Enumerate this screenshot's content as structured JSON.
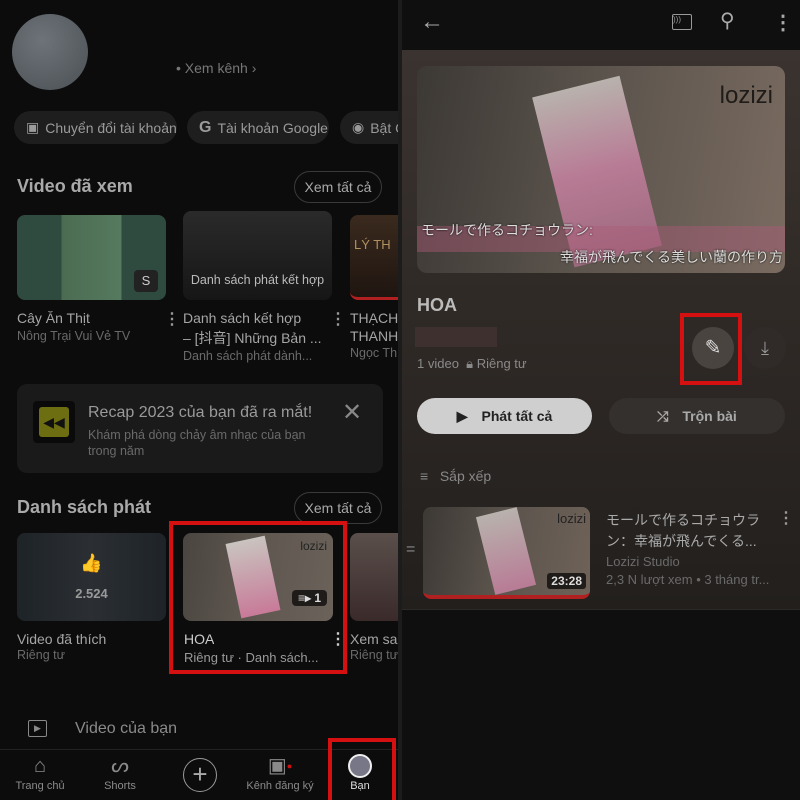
{
  "left": {
    "view_channel": "Xem kênh",
    "chips": [
      "Chuyển đổi tài khoản",
      "Tài khoản Google",
      "Bật C"
    ],
    "history": {
      "title": "Video đã xem",
      "see_all": "Xem tất cả",
      "items": [
        {
          "title": "Cây Ăn Thịt",
          "sub": "Nông Trại Vui Vẻ TV",
          "overlay": ""
        },
        {
          "title": "Danh sách kết hợp",
          "title2": "– [抖音] Những Bản ...",
          "sub": "Danh sách phát dành...",
          "overlay": "Danh sách phát kết hợp"
        },
        {
          "title": "THẠCH",
          "title2": "THANH",
          "sub": "Ngọc Th",
          "overlay": "LÝ TH"
        }
      ]
    },
    "recap": {
      "title": "Recap 2023 của bạn đã ra mắt!",
      "desc": "Khám phá dòng chảy âm nhạc của bạn trong năm"
    },
    "playlists": {
      "title": "Danh sách phát",
      "see_all": "Xem tất cả",
      "items": [
        {
          "title": "Video đã thích",
          "sub": "Riêng tư",
          "count": "2.524"
        },
        {
          "title": "HOA",
          "sub": "Riêng tư · Danh sách...",
          "count": "1",
          "brand": "lozizi"
        },
        {
          "title": "Xem sa",
          "sub": "Riêng tư"
        }
      ]
    },
    "your_videos": "Video của bạn",
    "nav": [
      {
        "label": "Trang chủ",
        "icon": "home-icon"
      },
      {
        "label": "Shorts",
        "icon": "shorts-icon"
      },
      {
        "label": "",
        "icon": "create-icon"
      },
      {
        "label": "Kênh đăng ký",
        "icon": "subscriptions-icon"
      },
      {
        "label": "Bạn",
        "icon": "you-avatar"
      }
    ]
  },
  "right": {
    "brand": "lozizi",
    "caption1": "モールで作るコチョウラン:",
    "caption2": "幸福が飛んでくる美しい蘭の作り方",
    "title": "HOA",
    "video_count": "1 video",
    "privacy": "Riêng tư",
    "play_all": "Phát tất cả",
    "shuffle": "Trộn bài",
    "sort": "Sắp xếp",
    "video": {
      "title1": "モールで作るコチョウラ",
      "title2": "ン：幸福が飛んでくる...",
      "channel": "Lozizi Studio",
      "meta": "2,3 N lượt xem • 3 tháng tr...",
      "duration": "23:28"
    }
  },
  "colors": {
    "highlight": "#d51010",
    "accent_red": "#e02020"
  }
}
